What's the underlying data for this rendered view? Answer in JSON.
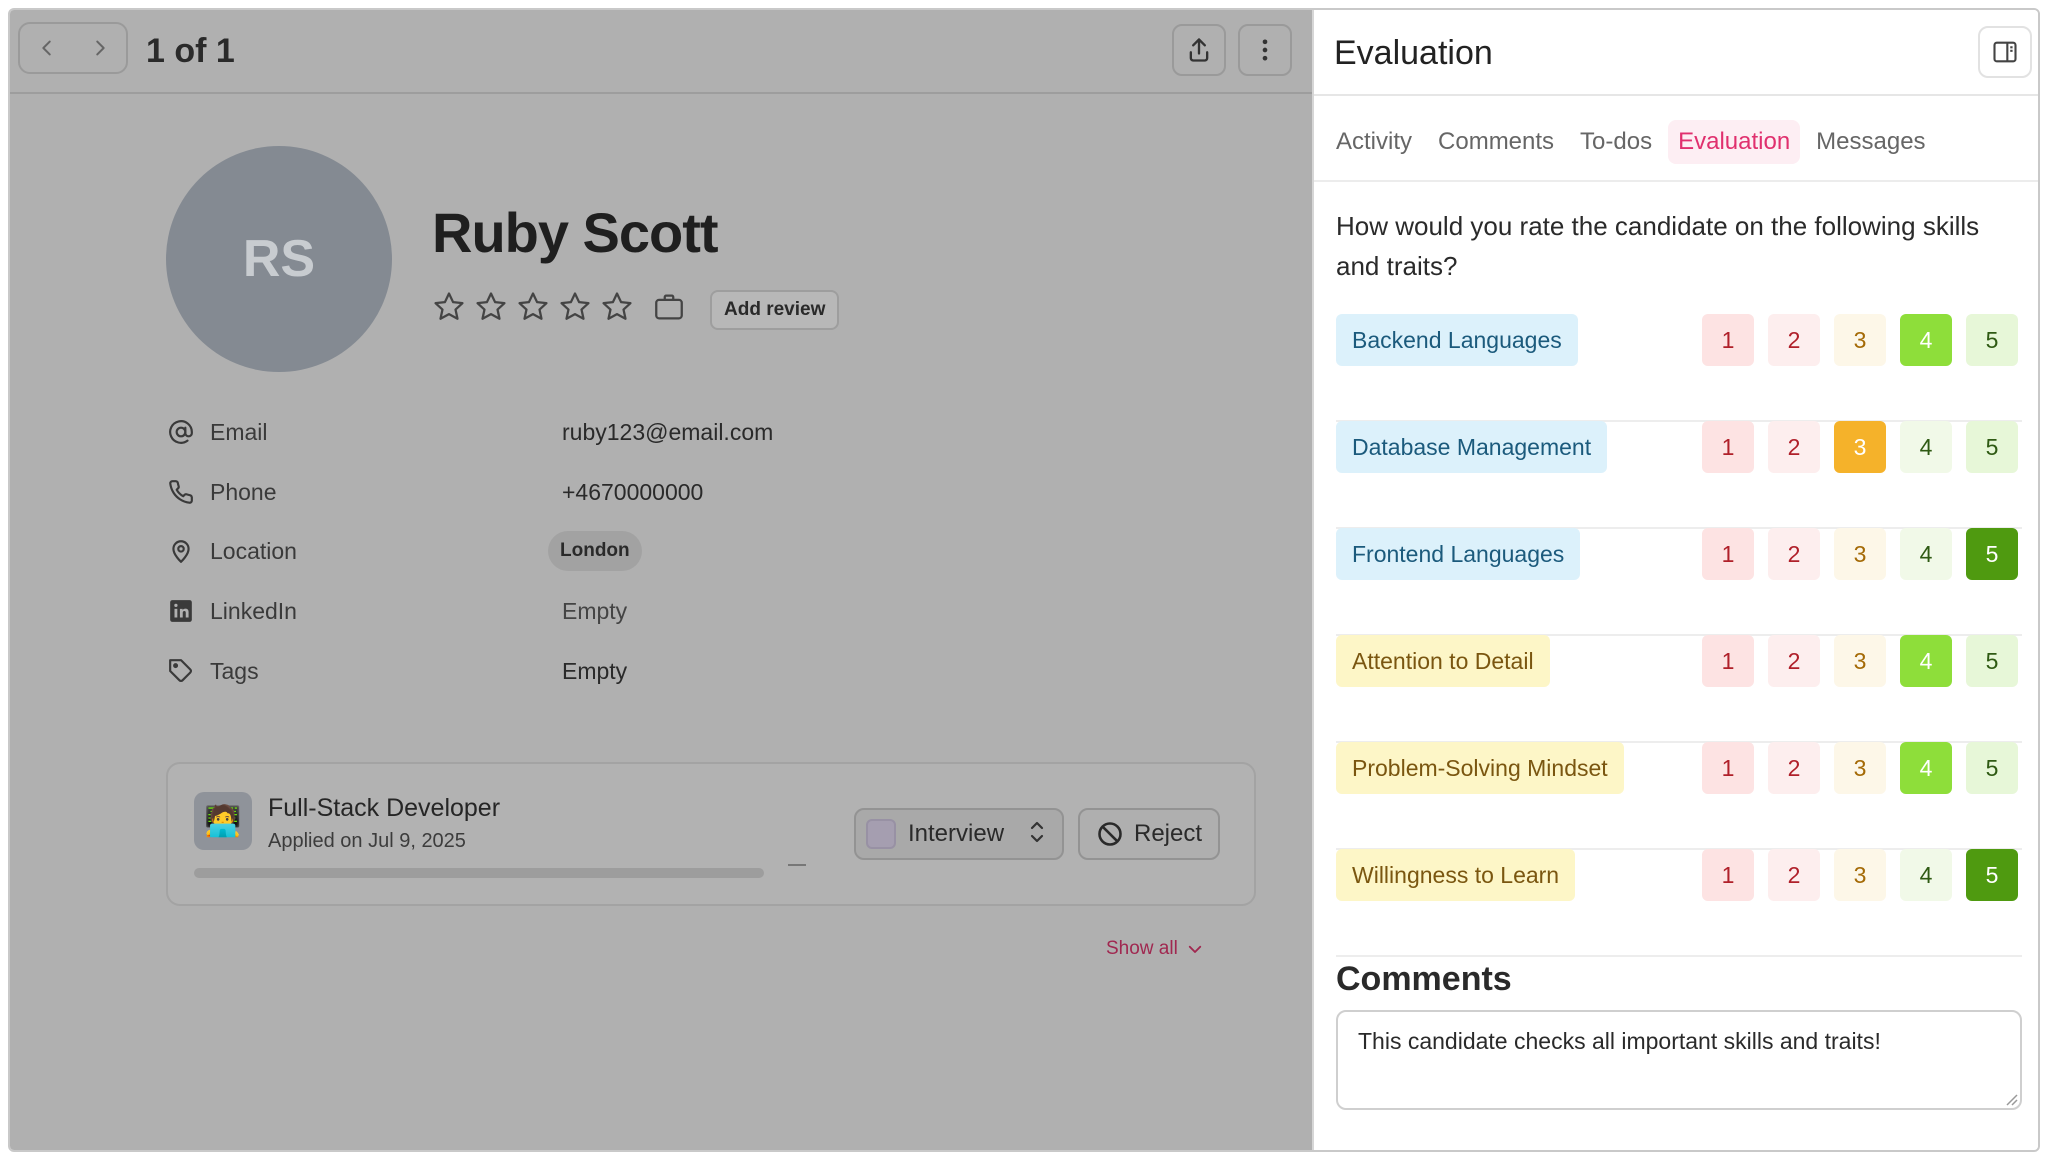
{
  "header": {
    "counter": "1 of 1"
  },
  "candidate": {
    "initials": "RS",
    "name": "Ruby Scott",
    "add_review_label": "Add review",
    "rating": 0,
    "rating_max": 5
  },
  "fields": {
    "email": {
      "label": "Email",
      "value": "ruby123@email.com"
    },
    "phone": {
      "label": "Phone",
      "value": "+4670000000"
    },
    "location": {
      "label": "Location",
      "value": "London"
    },
    "linkedin": {
      "label": "LinkedIn",
      "value": "Empty"
    },
    "tags": {
      "label": "Tags",
      "value": "Empty"
    }
  },
  "application": {
    "job_icon": "🧑‍💻",
    "title": "Full-Stack Developer",
    "applied": "Applied on Jul 9, 2025",
    "stage": "Interview",
    "reject_label": "Reject",
    "show_all_label": "Show all"
  },
  "panel": {
    "title": "Evaluation",
    "tabs": [
      "Activity",
      "Comments",
      "To-dos",
      "Evaluation",
      "Messages"
    ],
    "active_tab": "Evaluation",
    "question": "How would you rate the candidate on the following skills and traits?",
    "skills": [
      {
        "name": "Backend Languages",
        "color": "blue",
        "score": 4
      },
      {
        "name": "Database Management",
        "color": "blue",
        "score": 3
      },
      {
        "name": "Frontend Languages",
        "color": "blue",
        "score": 5
      },
      {
        "name": "Attention to Detail",
        "color": "yellow",
        "score": 4
      },
      {
        "name": "Problem-Solving Mindset",
        "color": "yellow",
        "score": 4
      },
      {
        "name": "Willingness to Learn",
        "color": "yellow",
        "score": 5
      }
    ],
    "score_options": [
      "1",
      "2",
      "3",
      "4",
      "5"
    ],
    "comments_title": "Comments",
    "comment_text": "This candidate checks all important skills and traits!"
  },
  "colors": {
    "accent": "#e0306e",
    "score3_selected": "#f5b22a",
    "score4_selected": "#8ede3a",
    "score5_selected": "#4f9a10"
  }
}
